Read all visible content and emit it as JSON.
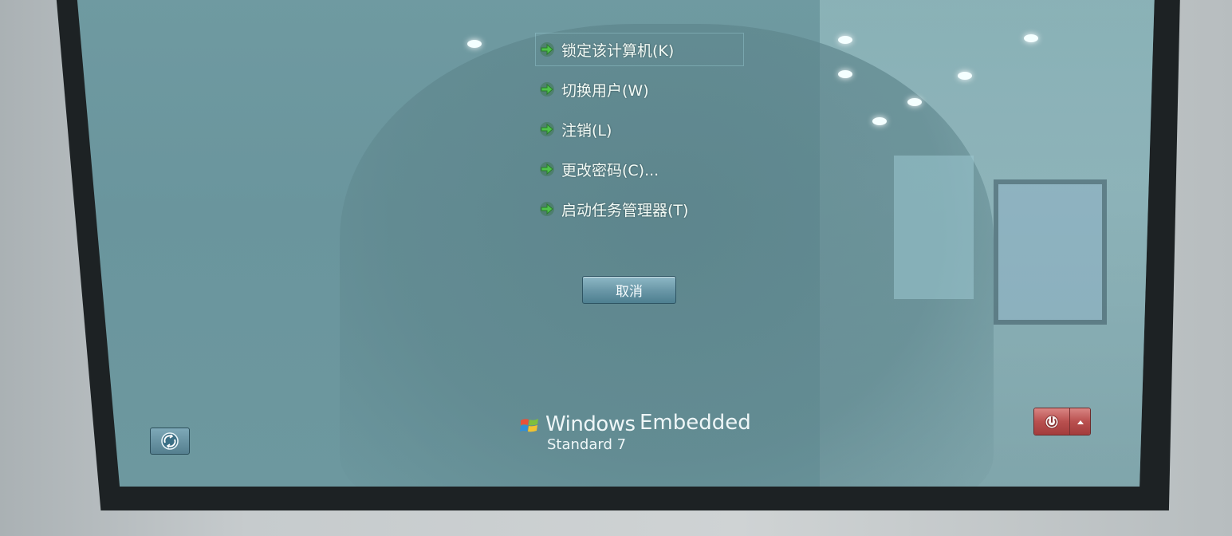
{
  "menu": {
    "items": [
      {
        "label": "锁定该计算机(K)"
      },
      {
        "label": "切换用户(W)"
      },
      {
        "label": "注销(L)"
      },
      {
        "label": "更改密码(C)..."
      },
      {
        "label": "启动任务管理器(T)"
      }
    ]
  },
  "cancel_label": "取消",
  "brand": {
    "windows": "Windows",
    "embedded": "Embedded",
    "edition": "Standard 7"
  },
  "icons": {
    "menu_arrow": "arrow-right-icon",
    "ease_of_access": "ease-of-access-icon",
    "power": "power-icon",
    "power_menu": "chevron-up-icon",
    "logo": "windows-flag-icon"
  },
  "colors": {
    "screen_background": "#6d989f",
    "arrow_green": "#4fc24a",
    "power_red": "#b9504f"
  }
}
